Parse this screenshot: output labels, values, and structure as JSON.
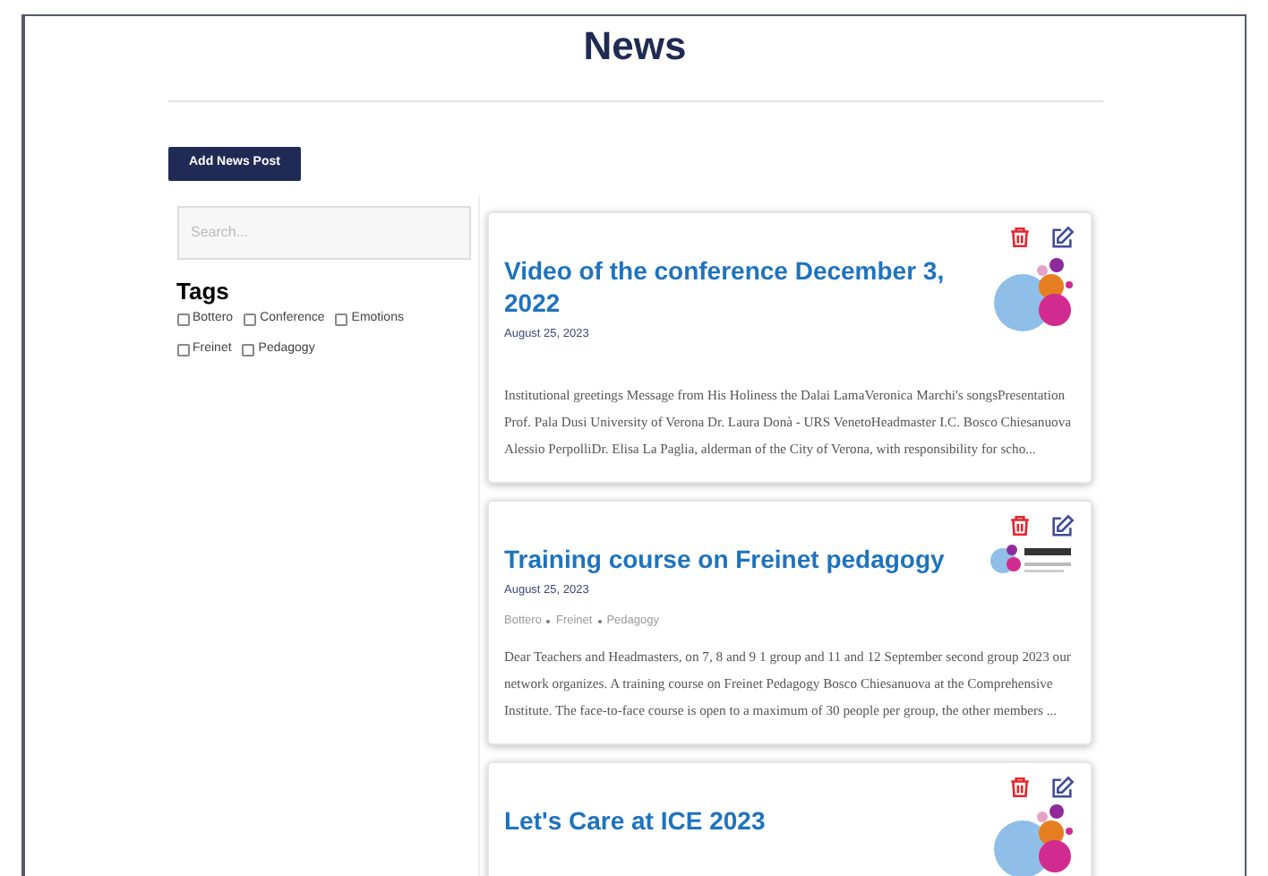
{
  "page": {
    "title": "News"
  },
  "add_button": "Add News Post",
  "sidebar": {
    "search": {
      "placeholder": "Search..."
    },
    "tags_heading": "Tags",
    "tags": [
      {
        "label": "Bottero",
        "checked": false
      },
      {
        "label": "Conference",
        "checked": false
      },
      {
        "label": "Emotions",
        "checked": false
      },
      {
        "label": "Freinet",
        "checked": false
      },
      {
        "label": "Pedagogy",
        "checked": false
      }
    ]
  },
  "posts": [
    {
      "kind": "round",
      "title": "Video of the conference December 3, 2022",
      "date": "August 25, 2023",
      "excerpt": "Institutional greetings Message from His Holiness the Dalai LamaVeronica Marchi's songsPresentation Prof. Pala Dusi University of Verona Dr. Laura Donà - URS VenetoHeadmaster I.C. Bosco Chiesanuova Alessio PerpolliDr. Elisa La Paglia, alderman of the City of Verona, with responsibility for scho..."
    },
    {
      "kind": "wide",
      "title": "Training course on Freinet pedagogy",
      "date": "August 25, 2023",
      "tags": [
        "Bottero",
        "Freinet",
        "Pedagogy"
      ],
      "excerpt": "Dear Teachers and Headmasters, on 7, 8 and 9 1 group and 11 and 12 September second group 2023 our network organizes. A training course on Freinet Pedagogy   Bosco Chiesanuova at the Comprehensive Institute. The face-to-face course is open to a maximum of 30 people per group, the other members ..."
    },
    {
      "kind": "round",
      "title": "Let's Care at ICE 2023"
    }
  ]
}
